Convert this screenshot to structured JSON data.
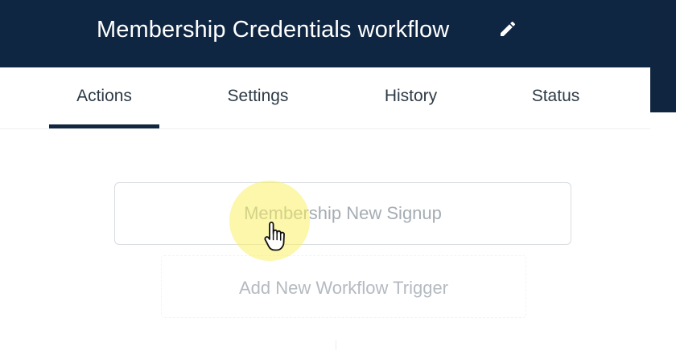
{
  "header": {
    "title": "Membership Credentials workflow",
    "edit_icon": "pencil-icon",
    "background": "#0f2642"
  },
  "tabs": [
    {
      "label": "Actions",
      "active": true
    },
    {
      "label": "Settings",
      "active": false
    },
    {
      "label": "History",
      "active": false
    },
    {
      "label": "Status",
      "active": false
    }
  ],
  "workflow": {
    "trigger_label": "Membership New Signup",
    "add_trigger_label": "Add New Workflow Trigger"
  },
  "cursor": {
    "icon": "hand-pointer-icon",
    "highlight_color": "#f9ef64"
  }
}
